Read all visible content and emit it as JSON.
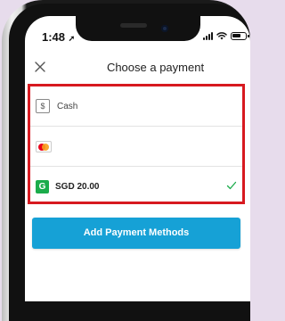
{
  "status_bar": {
    "time": "1:48",
    "location_arrow": "➚"
  },
  "header": {
    "title": "Choose a payment",
    "close_icon": "close-icon"
  },
  "payment_methods": [
    {
      "icon": "cash-icon",
      "icon_text": "$",
      "label": "Cash",
      "selected": false
    },
    {
      "icon": "mastercard-icon",
      "label": "",
      "selected": false
    },
    {
      "icon": "grabpay-icon",
      "icon_text": "G",
      "label": "SGD 20.00",
      "selected": true
    }
  ],
  "add_button": {
    "label": "Add Payment Methods"
  },
  "colors": {
    "highlight_border": "#d71920",
    "button": "#16a1d6",
    "check": "#1bac4b",
    "grabpay": "#1bac4b"
  }
}
